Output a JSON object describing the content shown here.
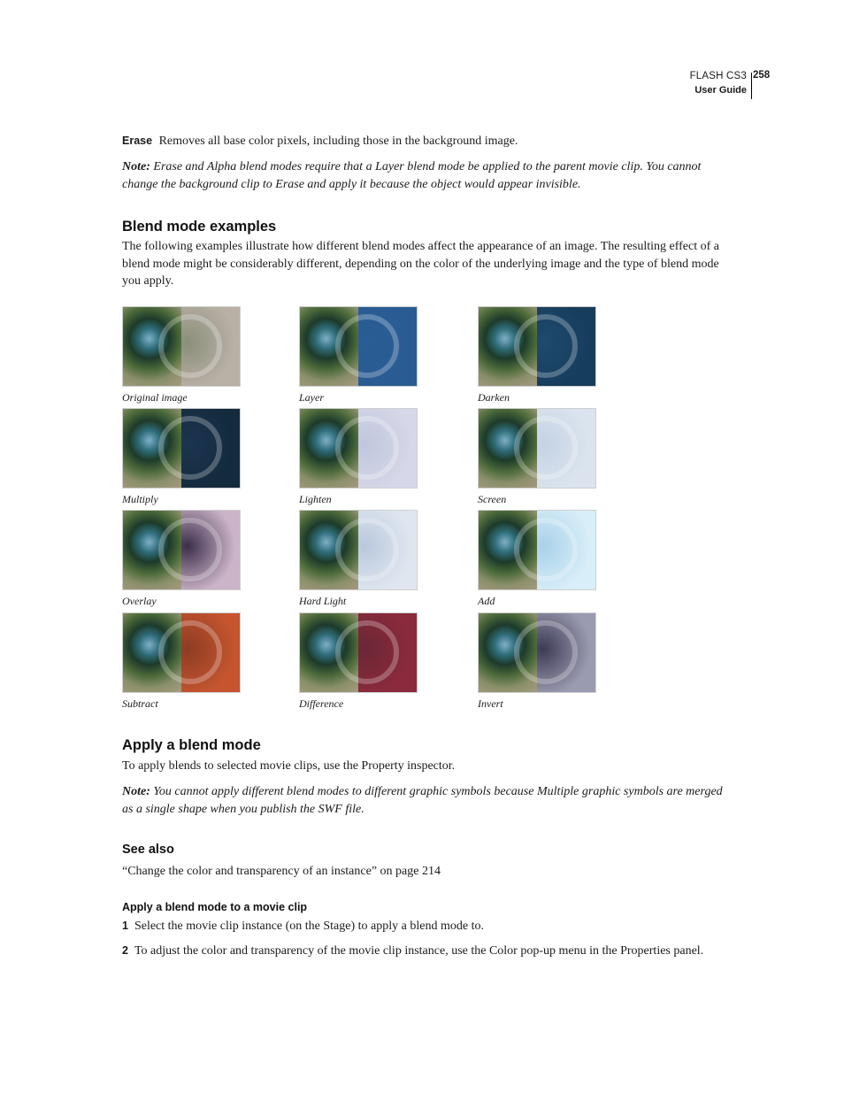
{
  "header": {
    "product": "FLASH CS3",
    "guide": "User Guide",
    "page_number": "258"
  },
  "erase": {
    "term": "Erase",
    "text": "Removes all base color pixels, including those in the background image."
  },
  "note1": {
    "label": "Note:",
    "text": " Erase and Alpha blend modes require that a Layer blend mode be applied to the parent movie clip. You cannot change the background clip to Erase and apply it because the object would appear invisible."
  },
  "blend_examples": {
    "heading": "Blend mode examples",
    "intro": "The following examples illustrate how different blend modes affect the appearance of an image. The resulting effect of a blend mode might be considerably different, depending on the color of the underlying image and the type of blend mode you apply.",
    "images": [
      {
        "caption": "Original image",
        "tint": "#8a8f7a",
        "right": "#b9b0a6"
      },
      {
        "caption": "Layer",
        "tint": "#2a5d95",
        "right": "#2b5b93"
      },
      {
        "caption": "Darken",
        "tint": "#1f4a6e",
        "right": "#163d5c"
      },
      {
        "caption": "Multiply",
        "tint": "#1c3550",
        "right": "#142a3d"
      },
      {
        "caption": "Lighten",
        "tint": "#bfc6dc",
        "right": "#d6d7e8"
      },
      {
        "caption": "Screen",
        "tint": "#c4d2e4",
        "right": "#dbe4ee"
      },
      {
        "caption": "Overlay",
        "tint": "#3b2d4a",
        "right": "#cbb4c8"
      },
      {
        "caption": "Hard Light",
        "tint": "#b9c8dc",
        "right": "#dfe6f0"
      },
      {
        "caption": "Add",
        "tint": "#a9d1ea",
        "right": "#d8eef8"
      },
      {
        "caption": "Subtract",
        "tint": "#8e3b24",
        "right": "#c4552f"
      },
      {
        "caption": "Difference",
        "tint": "#6b2735",
        "right": "#8b2a3c"
      },
      {
        "caption": "Invert",
        "tint": "#3c3a55",
        "right": "#9a9bb0"
      }
    ]
  },
  "apply_blend": {
    "heading": "Apply a blend mode",
    "text": "To apply blends to selected movie clips, use the Property inspector."
  },
  "note2": {
    "label": "Note:",
    "text": " You cannot apply different blend modes to different graphic symbols because Multiple graphic symbols are merged as a single shape when you publish the SWF file."
  },
  "see_also": {
    "heading": "See also",
    "link": "“Change the color and transparency of an instance” on page 214"
  },
  "procedure": {
    "heading": "Apply a blend mode to a movie clip",
    "steps": [
      {
        "num": "1",
        "text": "Select the movie clip instance (on the Stage) to apply a blend mode to."
      },
      {
        "num": "2",
        "text": "To adjust the color and transparency of the movie clip instance, use the Color pop-up menu in the Properties panel."
      }
    ]
  }
}
